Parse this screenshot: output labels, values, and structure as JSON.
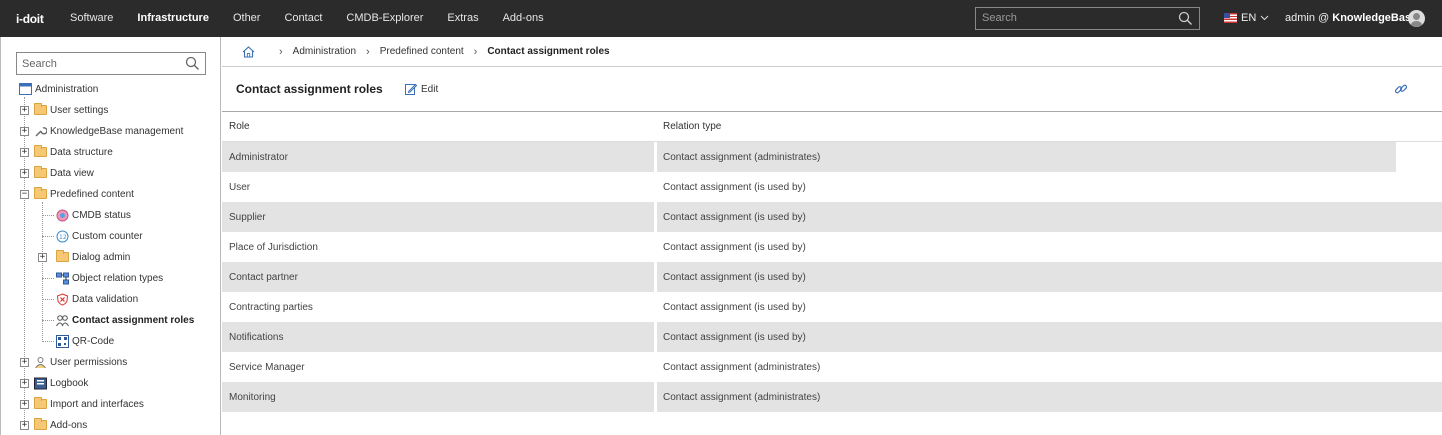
{
  "app": {
    "logo": "i-doit"
  },
  "nav": {
    "items": [
      {
        "label": "Software",
        "active": false
      },
      {
        "label": "Infrastructure",
        "active": true
      },
      {
        "label": "Other",
        "active": false
      },
      {
        "label": "Contact",
        "active": false
      },
      {
        "label": "CMDB-Explorer",
        "active": false
      },
      {
        "label": "Extras",
        "active": false
      },
      {
        "label": "Add-ons",
        "active": false
      }
    ],
    "search_placeholder": "Search",
    "language": "EN",
    "user_prefix": "admin @ ",
    "user_tenant": "KnowledgeBase"
  },
  "sidebar": {
    "search_placeholder": "Search",
    "root": "Administration",
    "items": [
      {
        "label": "User settings"
      },
      {
        "label": "KnowledgeBase management"
      },
      {
        "label": "Data structure"
      },
      {
        "label": "Data view"
      },
      {
        "label": "Predefined content"
      },
      {
        "label": "CMDB status"
      },
      {
        "label": "Custom counter"
      },
      {
        "label": "Dialog admin"
      },
      {
        "label": "Object relation types"
      },
      {
        "label": "Data validation"
      },
      {
        "label": "Contact assignment roles"
      },
      {
        "label": "QR-Code"
      },
      {
        "label": "User permissions"
      },
      {
        "label": "Logbook"
      },
      {
        "label": "Import and interfaces"
      },
      {
        "label": "Add-ons"
      }
    ]
  },
  "breadcrumb": {
    "items": [
      "Administration",
      "Predefined content"
    ],
    "current": "Contact assignment roles"
  },
  "page": {
    "title": "Contact assignment roles",
    "edit_label": "Edit"
  },
  "table": {
    "columns": [
      "Role",
      "Relation type"
    ],
    "rows": [
      [
        "Administrator",
        "Contact assignment (administrates)"
      ],
      [
        "User",
        "Contact assignment (is used by)"
      ],
      [
        "Supplier",
        "Contact assignment (is used by)"
      ],
      [
        "Place of Jurisdiction",
        "Contact assignment (is used by)"
      ],
      [
        "Contact partner",
        "Contact assignment (is used by)"
      ],
      [
        "Contracting parties",
        "Contact assignment (is used by)"
      ],
      [
        "Notifications",
        "Contact assignment (is used by)"
      ],
      [
        "Service Manager",
        "Contact assignment (administrates)"
      ],
      [
        "Monitoring",
        "Contact assignment (administrates)"
      ]
    ]
  },
  "colors": {
    "topbar": "#2b2b2b",
    "row_stripe": "#e3e3e3",
    "folder": "#f7c873",
    "link_icon": "#3b6fb6"
  }
}
